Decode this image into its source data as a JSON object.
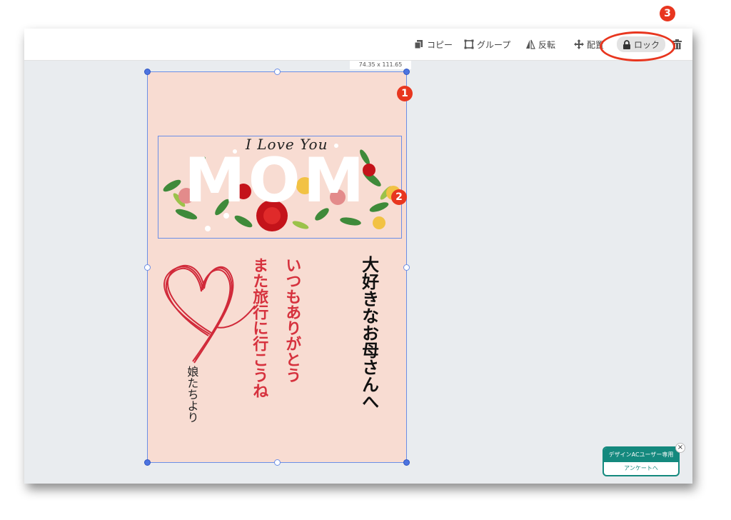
{
  "toolbar": {
    "copy_label": "コピー",
    "group_label": "グループ",
    "flip_label": "反転",
    "arrange_label": "配置",
    "lock_label": "ロック"
  },
  "selection": {
    "size_text": "74.35 x 111.65"
  },
  "card": {
    "heading": "I Love You",
    "mom_text": "MOM",
    "dear_text": "大好きなお母さんへ",
    "message_line1": "いつもありがとう",
    "message_line2": "また旅行に行こうね",
    "from_text": "娘たちより"
  },
  "annotations": {
    "badge1": "1",
    "badge2": "2",
    "badge3": "3"
  },
  "survey": {
    "title": "デザインACユーザー専用",
    "link": "アンケートへ",
    "close": "×"
  },
  "colors": {
    "card_bg": "#f8dcd2",
    "selection": "#6b8ee6",
    "annotation_red": "#e8361f",
    "message_red": "#d6323e",
    "survey_teal": "#14897e"
  },
  "icons": [
    "copy-icon",
    "group-icon",
    "flip-icon",
    "move-icon",
    "lock-icon",
    "trash-icon"
  ]
}
